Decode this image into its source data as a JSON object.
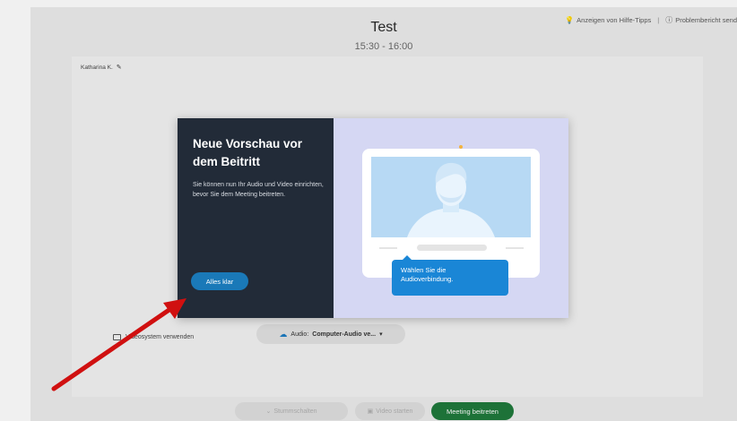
{
  "meeting": {
    "title": "Test",
    "time": "15:30 - 16:00",
    "participant_name": "Katharina K.",
    "tips_link": "Anzeigen von Hilfe-Tipps",
    "report_link": "Problembericht send",
    "video_system_label": "Videosystem verwenden",
    "audio_label": "Audio:",
    "audio_value": "Computer-Audio ve...",
    "mute_button": "Stummschalten",
    "video_button": "Video starten",
    "join_button": "Meeting beitreten"
  },
  "dialog": {
    "heading": "Neue Vorschau vor dem Beitritt",
    "body": "Sie können nun Ihr Audio und Video einrichten, bevor Sie dem Meeting beitreten.",
    "ok_button": "Alles klar",
    "tooltip": "Wählen Sie die Audioverbindung."
  },
  "colors": {
    "dialog_left_bg": "#222b38",
    "dialog_right_bg": "#d5d7f3",
    "accent_blue": "#1a86d6",
    "join_green": "#1f7a3c",
    "annotation_arrow": "#d01010"
  },
  "icons": [
    "lightbulb-icon",
    "help-circle-icon",
    "pencil-icon",
    "video-system-icon",
    "cloud-audio-icon",
    "chevron-down-icon",
    "microphone-icon",
    "camera-icon"
  ]
}
